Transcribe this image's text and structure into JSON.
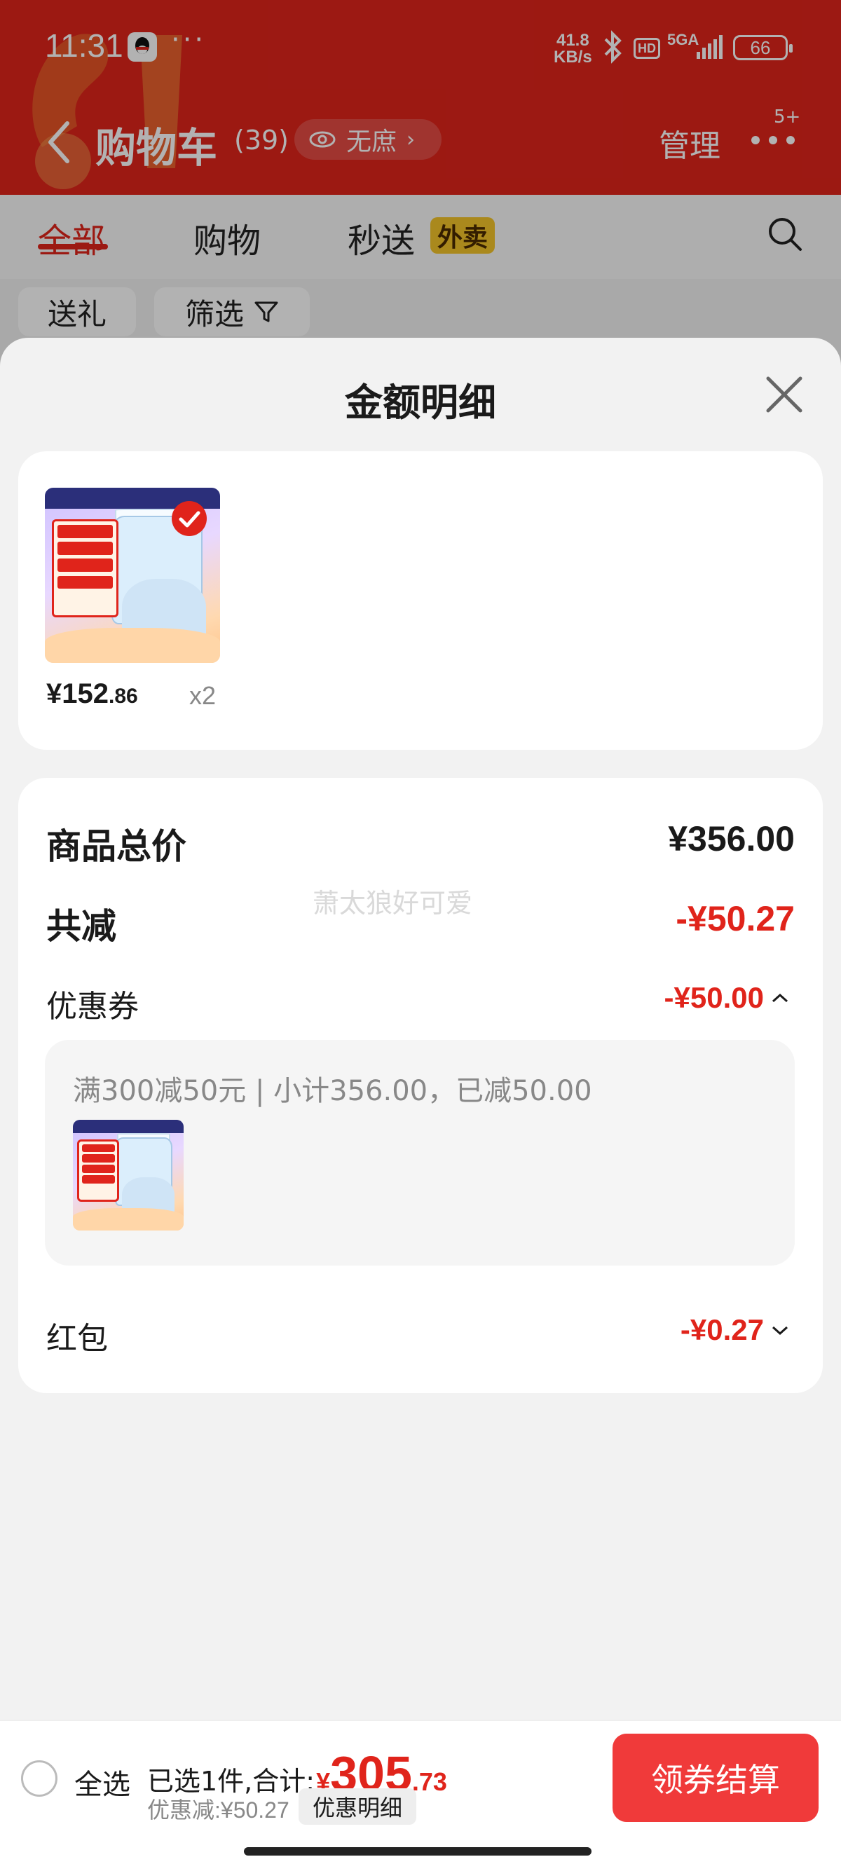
{
  "status_bar": {
    "time": "11:31",
    "net_speed_value": "41.8",
    "net_speed_unit": "KB/s",
    "hd_label": "HD",
    "network": "5GA",
    "battery": "66"
  },
  "nav": {
    "title": "购物车",
    "count": "(39)",
    "pill_label": "无庶",
    "manage_label": "管理",
    "more_badge": "5+"
  },
  "tabs": [
    {
      "label": "全部",
      "active": true
    },
    {
      "label": "购物",
      "active": false
    },
    {
      "label": "秒送",
      "active": false
    }
  ],
  "tab_tag": "外卖",
  "filters": [
    {
      "label": "送礼"
    },
    {
      "label": "筛选"
    }
  ],
  "sheet": {
    "title": "金额明细",
    "product": {
      "price_main": "¥152",
      "price_decimal": ".86",
      "quantity": "x2"
    },
    "total_label": "商品总价",
    "total_value": "¥356.00",
    "reduce_label": "共减",
    "reduce_value": "-¥50.27",
    "watermark": "萧太狼好可爱",
    "coupon_label": "优惠券",
    "coupon_value": "-¥50.00",
    "coupon_detail": "满300减50元 | 小计356.00，已减50.00",
    "redpacket_label": "红包",
    "redpacket_value": "-¥0.27"
  },
  "bottom_bar": {
    "select_all_label": "全选",
    "summary_prefix": "已选1件,合计:",
    "yen": "¥",
    "total_int": "305",
    "total_dec": ".73",
    "discount_text": "优惠减:¥50.27",
    "detail_chip": "优惠明细",
    "checkout_label": "领券结算"
  },
  "colors": {
    "accent": "#e0241b",
    "checkout": "#f03a3a",
    "tag_yellow": "#f4c42a"
  }
}
